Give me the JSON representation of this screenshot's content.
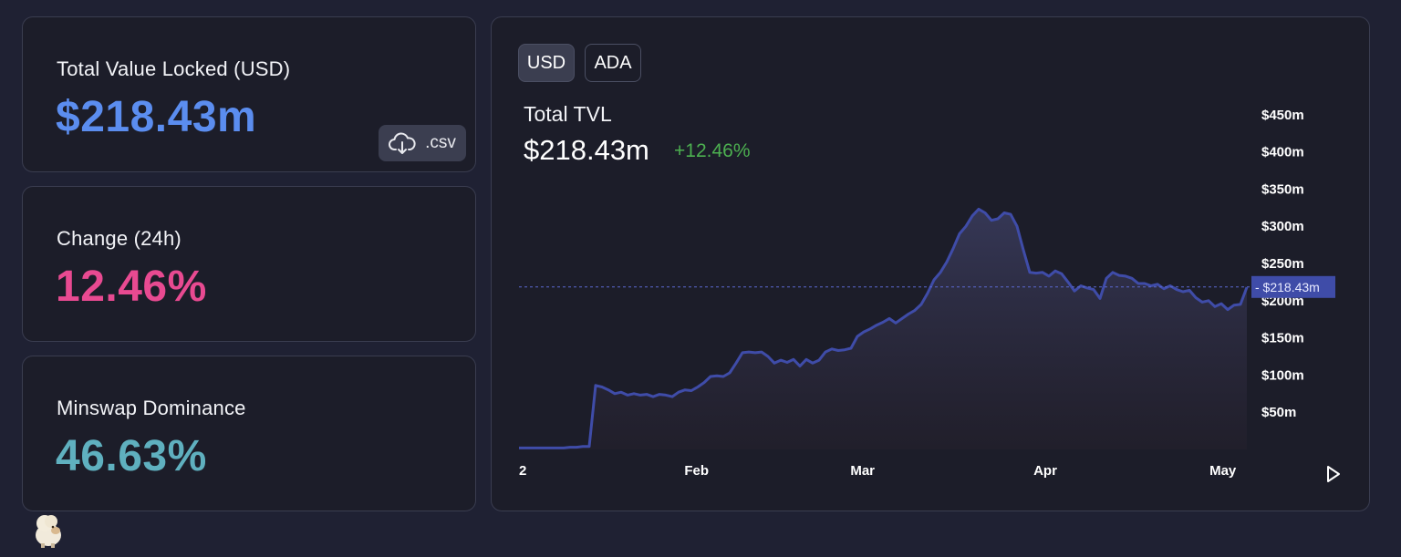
{
  "stats": {
    "tvl_label": "Total Value Locked (USD)",
    "tvl_value": "$218.43m",
    "csv_label": ".csv",
    "change_label": "Change (24h)",
    "change_value": "12.46%",
    "dominance_label": "Minswap Dominance",
    "dominance_value": "46.63%"
  },
  "colors": {
    "tvl": "#5b8def",
    "change": "#e84a91",
    "dominance": "#5fb0bf",
    "line": "#3f4ca8",
    "positive": "#4caf50",
    "price_tag": "#3f4ca8"
  },
  "chart_controls": {
    "usd_label": "USD",
    "ada_label": "ADA",
    "active": "USD"
  },
  "chart_header": {
    "title": "Total TVL",
    "value": "$218.43m",
    "change": "+12.46%"
  },
  "chart_data": {
    "type": "area",
    "title": "Total TVL",
    "y_ticks": [
      "$50m",
      "$100m",
      "$150m",
      "$200m",
      "$250m",
      "$300m",
      "$350m",
      "$400m",
      "$450m"
    ],
    "x_ticks": [
      "2",
      "Feb",
      "Mar",
      "Apr",
      "May"
    ],
    "ylim": [
      0,
      470
    ],
    "current_value_label": "$218.43m",
    "current_value": 218.43,
    "series": [
      {
        "values": [
          2,
          2,
          2,
          2,
          2,
          2,
          2,
          2,
          3,
          3,
          4,
          4,
          86,
          84,
          80,
          75,
          77,
          73,
          75,
          73,
          74,
          71,
          74,
          73,
          71,
          77,
          80,
          79,
          84,
          90,
          98,
          99,
          98,
          103,
          116,
          130,
          131,
          130,
          131,
          125,
          116,
          120,
          117,
          121,
          112,
          121,
          116,
          120,
          131,
          135,
          133,
          134,
          136,
          152,
          158,
          162,
          167,
          171,
          176,
          170,
          176,
          182,
          187,
          195,
          210,
          228,
          238,
          252,
          270,
          290,
          300,
          314,
          323,
          318,
          308,
          310,
          318,
          316,
          300,
          268,
          238,
          237,
          238,
          233,
          240,
          236,
          225,
          213,
          220,
          217,
          215,
          203,
          230,
          238,
          234,
          233,
          230,
          223,
          223,
          220,
          222,
          216,
          220,
          215,
          212,
          214,
          204,
          198,
          200,
          192,
          196,
          188,
          194,
          195,
          218
        ]
      }
    ]
  }
}
